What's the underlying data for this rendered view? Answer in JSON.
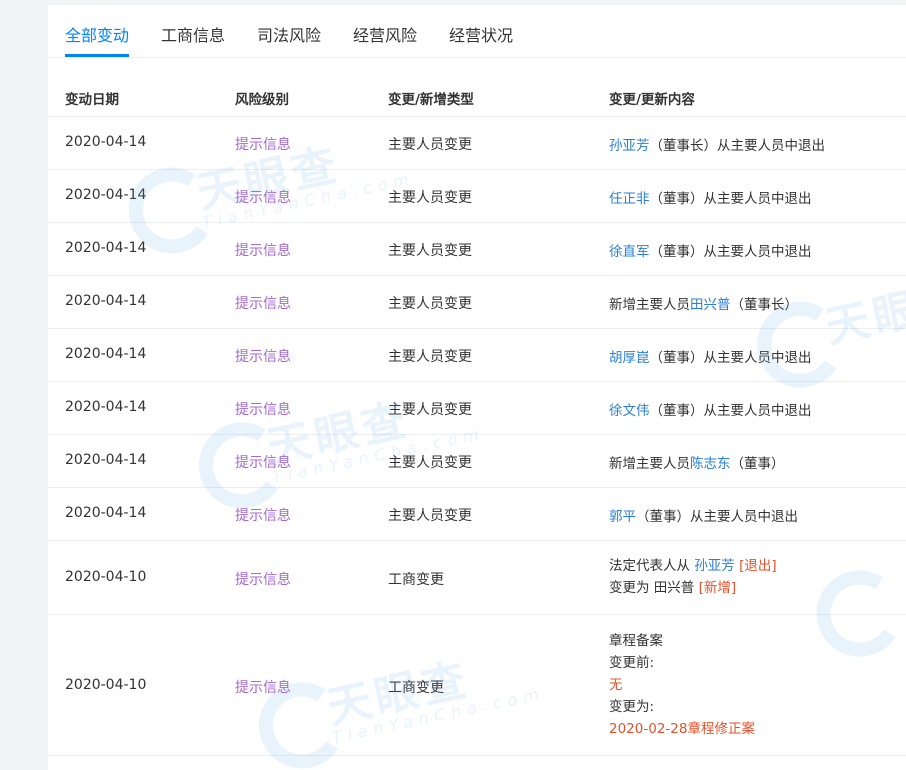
{
  "tabs": [
    {
      "label": "全部变动",
      "active": true
    },
    {
      "label": "工商信息",
      "active": false
    },
    {
      "label": "司法风险",
      "active": false
    },
    {
      "label": "经营风险",
      "active": false
    },
    {
      "label": "经营状况",
      "active": false
    }
  ],
  "columns": {
    "date": "变动日期",
    "risk": "风险级别",
    "type": "变更/新增类型",
    "content": "变更/更新内容"
  },
  "rows": [
    {
      "date": "2020-04-14",
      "risk": "提示信息",
      "type": "主要人员变更",
      "c_pre": "",
      "c_link": "孙亚芳",
      "c_post": "（董事长）从主要人员中退出"
    },
    {
      "date": "2020-04-14",
      "risk": "提示信息",
      "type": "主要人员变更",
      "c_pre": "",
      "c_link": "任正非",
      "c_post": "（董事）从主要人员中退出"
    },
    {
      "date": "2020-04-14",
      "risk": "提示信息",
      "type": "主要人员变更",
      "c_pre": "",
      "c_link": "徐直军",
      "c_post": "（董事）从主要人员中退出"
    },
    {
      "date": "2020-04-14",
      "risk": "提示信息",
      "type": "主要人员变更",
      "c_pre": "新增主要人员",
      "c_link": "田兴普",
      "c_post": "（董事长）"
    },
    {
      "date": "2020-04-14",
      "risk": "提示信息",
      "type": "主要人员变更",
      "c_pre": "",
      "c_link": "胡厚崑",
      "c_post": "（董事）从主要人员中退出"
    },
    {
      "date": "2020-04-14",
      "risk": "提示信息",
      "type": "主要人员变更",
      "c_pre": "",
      "c_link": "徐文伟",
      "c_post": "（董事）从主要人员中退出"
    },
    {
      "date": "2020-04-14",
      "risk": "提示信息",
      "type": "主要人员变更",
      "c_pre": "新增主要人员",
      "c_link": "陈志东",
      "c_post": "（董事）"
    },
    {
      "date": "2020-04-14",
      "risk": "提示信息",
      "type": "主要人员变更",
      "c_pre": "",
      "c_link": "郭平",
      "c_post": "（董事）从主要人员中退出"
    }
  ],
  "row9": {
    "date": "2020-04-10",
    "risk": "提示信息",
    "type": "工商变更",
    "line1_pre": "法定代表人从 ",
    "line1_link": "孙亚芳",
    "line1_tag": " [退出]",
    "line2_pre": "变更为 田兴普",
    "line2_tag": " [新增]"
  },
  "row10": {
    "date": "2020-04-10",
    "risk": "提示信息",
    "type": "工商变更",
    "l1": "章程备案",
    "l2": "变更前:",
    "l3": "无",
    "l4": "变更为:",
    "l5": "2020-02-28章程修正案"
  },
  "watermark": {
    "cn": "天眼查",
    "en": "TianYanCha.com"
  },
  "colors": {
    "accent": "#0084ff",
    "risk": "#a569d4",
    "link": "#2a7fd4",
    "tag": "#e5522a"
  }
}
